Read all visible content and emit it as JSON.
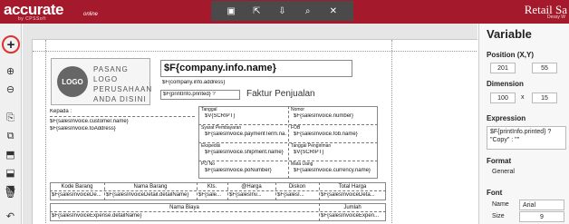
{
  "app": {
    "brand": "accurate",
    "brand_sub": "by CPSSoft",
    "brand_online": "online",
    "window_title": "Retail Sa",
    "user": "Dessy W"
  },
  "toolbar": {
    "icons": [
      "save-icon",
      "export-icon",
      "download-icon",
      "preview-icon",
      "close-icon"
    ],
    "glyphs": [
      "▣",
      "⇱",
      "⇩",
      "⌕",
      "✕"
    ]
  },
  "left_tools": {
    "glyphs": [
      "+",
      "⊕",
      "⊖",
      "⎘",
      "⧉",
      "⬒",
      "⬓",
      "⬔",
      "🗑",
      "↶"
    ]
  },
  "canvas": {
    "logo_circle": "LOGO",
    "logo_lines": [
      "PASANG LOGO",
      "PERUSAHAAN",
      "ANDA DISINI"
    ],
    "company_name": "$F{company.info.name}",
    "company_address": "$F{company.info.address}",
    "printed": "$F{printInfo.printed} ?",
    "doc_title": "Faktur Penjualan",
    "kepada": "Kepada :",
    "customer": "$F{salesInvoice.customer.name}",
    "to_address": "$F{salesInvoice.toAddress}",
    "tanggal_label": "Tanggal",
    "tanggal_value": "$V{SCRIPT}",
    "nomor_label": "Nomor",
    "nomor_value": "$F{salesInvoice.number}",
    "syarat_label": "Syarat Pembayaran",
    "syarat_value": "$F{salesInvoice.paymentTerm.na...",
    "fob_label": "FOB",
    "fob_value": "$F{salesInvoice.fob.name}",
    "ekspedisi_label": "Ekspedisi",
    "ekspedisi_value": "$F{salesInvoice.shipment.name}",
    "tglkirim_label": "Tanggal Pengiriman",
    "tglkirim_value": "$V{SCRIPT}",
    "po_label": "PO No",
    "po_value": "$F{salesInvoice.poNumber}",
    "mata_label": "Mata Uang",
    "mata_value": "$F{salesInvoice.currency.name}",
    "table_headers": [
      "Kode Barang",
      "Nama Barang",
      "Kts.",
      "@Harga",
      "Diskon",
      "Total Harga"
    ],
    "table_cells": [
      "$F{salesInvoiceDe...",
      "$F{salesInvoiceDetail.detailName}",
      "$F{sale...",
      "$F{salesInv...",
      "$F{salesI...",
      "$F{salesInvoiceDeta..."
    ],
    "biaya_headers": [
      "Nama Biaya",
      "Jumlah"
    ],
    "biaya_cells": [
      "$F{salesInvoiceExpense.detailName}",
      "$F{salesInvoiceExpen..."
    ]
  },
  "panel": {
    "title": "Variable",
    "position_label": "Position (X,Y)",
    "pos_x": "201",
    "pos_y": "55",
    "dimension_label": "Dimension",
    "dim_w": "100",
    "dim_h": "15",
    "x_sep": "x",
    "expression_label": "Expression",
    "expression": "$F{printInfo.printed} ? \"Copy\" : \"\"",
    "format_label": "Format",
    "format_value": "General",
    "font_label": "Font",
    "name_label": "Name",
    "name_value": "Arial",
    "size_label": "Size",
    "size_value": "9"
  },
  "colors": {
    "brand": "#a4192b",
    "toolbar": "#4a4a4a"
  }
}
